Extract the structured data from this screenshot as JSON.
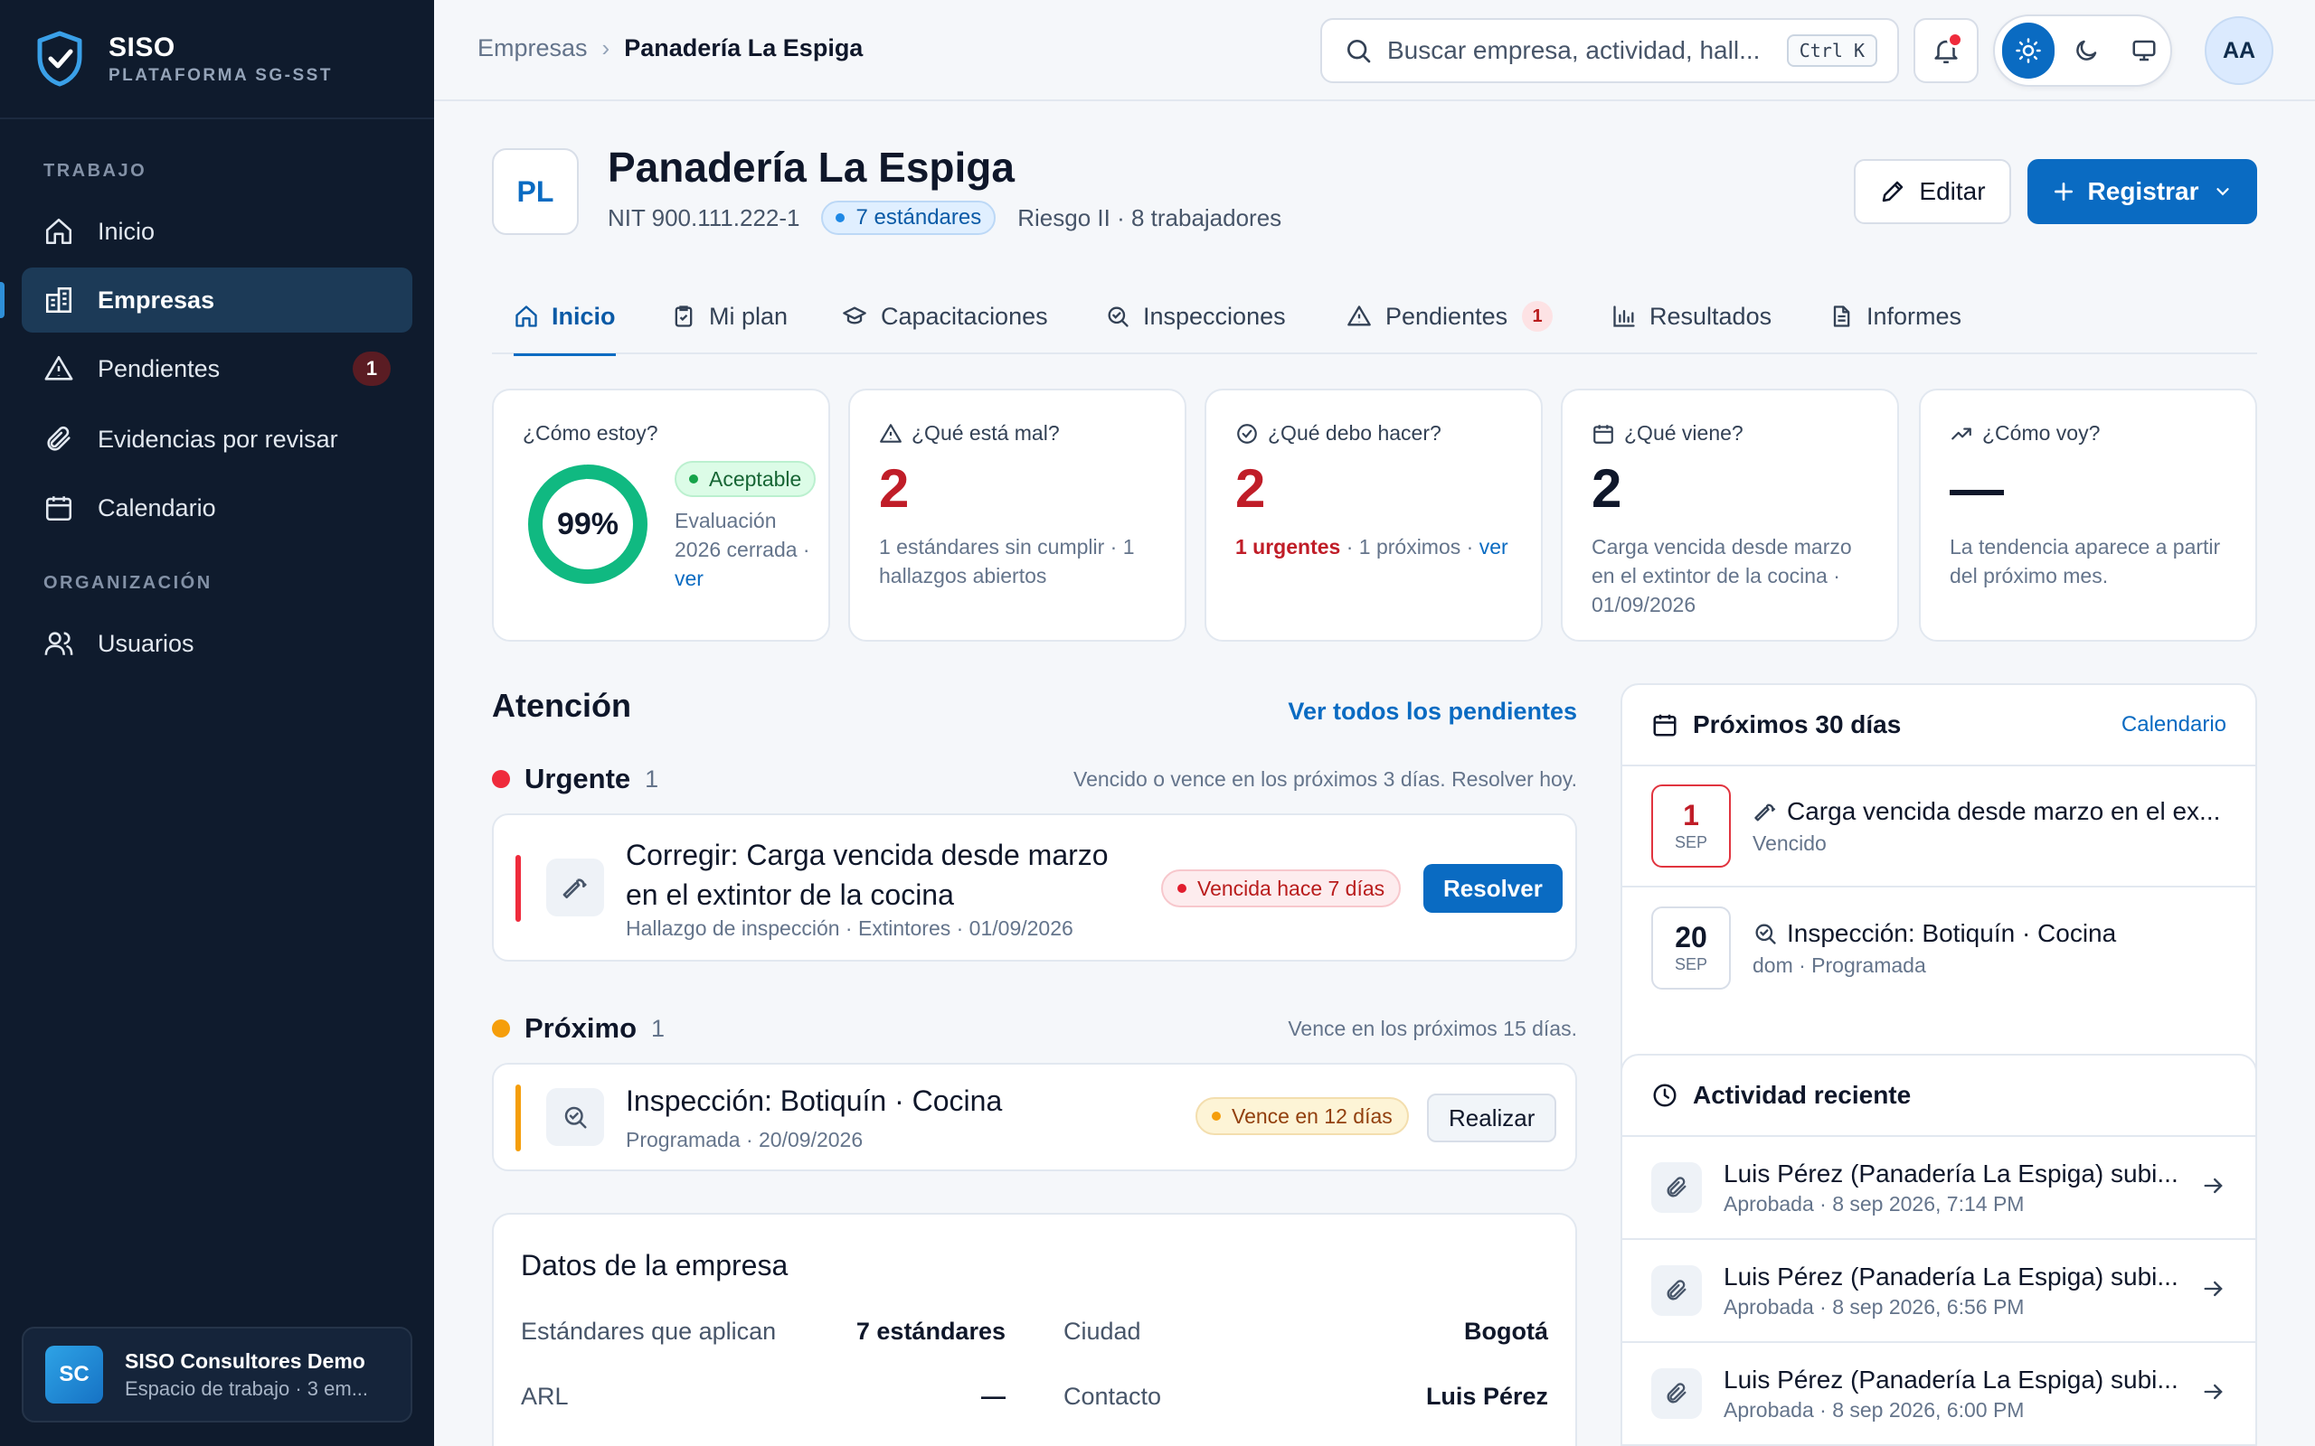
{
  "brand": {
    "name": "SISO",
    "subtitle": "PLATAFORMA SG-SST"
  },
  "sidebar": {
    "section_work": "TRABAJO",
    "section_org": "ORGANIZACIÓN",
    "items": [
      {
        "label": "Inicio"
      },
      {
        "label": "Empresas"
      },
      {
        "label": "Pendientes",
        "badge": "1"
      },
      {
        "label": "Evidencias por revisar"
      },
      {
        "label": "Calendario"
      },
      {
        "label": "Usuarios"
      }
    ],
    "workspace": {
      "initials": "SC",
      "name": "SISO Consultores Demo",
      "sub": "Espacio de trabajo · 3 em..."
    }
  },
  "topbar": {
    "breadcrumb": [
      "Empresas",
      "Panadería La Espiga"
    ],
    "search_placeholder": "Buscar empresa, actividad, hall...",
    "shortcut": "Ctrl K",
    "user_initials": "AA"
  },
  "company": {
    "initials": "PL",
    "name": "Panadería La Espiga",
    "nit": "NIT 900.111.222-1",
    "standards_pill": "7 estándares",
    "risk": "Riesgo II · 8 trabajadores",
    "edit_label": "Editar",
    "register_label": "Registrar"
  },
  "tabs": [
    {
      "label": "Inicio"
    },
    {
      "label": "Mi plan"
    },
    {
      "label": "Capacitaciones"
    },
    {
      "label": "Inspecciones"
    },
    {
      "label": "Pendientes",
      "badge": "1"
    },
    {
      "label": "Resultados"
    },
    {
      "label": "Informes"
    }
  ],
  "kpis": {
    "status": {
      "title": "¿Cómo estoy?",
      "percent": "99%",
      "percent_value": 99,
      "badge": "Aceptable",
      "desc_a": "Evaluación 2026 cerrada · ",
      "desc_link": "ver"
    },
    "wrong": {
      "title": "¿Qué está mal?",
      "value": "2",
      "desc": "1 estándares sin cumplir · 1 hallazgos abiertos"
    },
    "todo": {
      "title": "¿Qué debo hacer?",
      "value": "2",
      "desc_urgent": "1 urgentes",
      "desc_rest": " · 1 próximos · ",
      "desc_link": "ver"
    },
    "next": {
      "title": "¿Qué viene?",
      "value": "2",
      "desc": "Carga vencida desde marzo en el extintor de la cocina · 01/09/2026"
    },
    "trend": {
      "title": "¿Cómo voy?",
      "value": "—",
      "desc": "La tendencia aparece a partir del próximo mes."
    }
  },
  "attention": {
    "title": "Atención",
    "see_all": "Ver todos los pendientes",
    "urgent": {
      "label": "Urgente",
      "count": "1",
      "note": "Vencido o vence en los próximos 3 días. Resolver hoy.",
      "task": {
        "title": "Corregir: Carga vencida desde marzo en el extintor de la cocina",
        "meta": "Hallazgo de inspección · Extintores    · 01/09/2026",
        "chip": "Vencida hace 7 días",
        "action": "Resolver"
      }
    },
    "upcoming": {
      "label": "Próximo",
      "count": "1",
      "note": "Vence en los próximos 15 días.",
      "task": {
        "title": "Inspección: Botiquín · Cocina",
        "meta": "Programada   · 20/09/2026",
        "chip": "Vence en 12 días",
        "action": "Realizar"
      }
    }
  },
  "company_data": {
    "title": "Datos de la empresa",
    "rows": [
      {
        "label": "Estándares que aplican",
        "value": "7 estándares",
        "label2": "Ciudad",
        "value2": "Bogotá"
      },
      {
        "label": "ARL",
        "value": "—",
        "label2": "Contacto",
        "value2": "Luis Pérez"
      }
    ]
  },
  "upcoming30": {
    "title": "Próximos 30 días",
    "link": "Calendario",
    "events": [
      {
        "day": "1",
        "month": "SEP",
        "title": "Carga vencida desde marzo en el ex...",
        "sub": "Vencido"
      },
      {
        "day": "20",
        "month": "SEP",
        "title": "Inspección: Botiquín · Cocina",
        "sub": "dom · Programada"
      }
    ]
  },
  "activity": {
    "title": "Actividad reciente",
    "items": [
      {
        "title": "Luis Pérez (Panadería La Espiga) subi...",
        "sub": "Aprobada · 8 sep 2026, 7:14 PM"
      },
      {
        "title": "Luis Pérez (Panadería La Espiga) subi...",
        "sub": "Aprobada · 8 sep 2026, 6:56 PM"
      },
      {
        "title": "Luis Pérez (Panadería La Espiga) subi...",
        "sub": "Aprobada · 8 sep 2026, 6:00 PM"
      }
    ]
  },
  "colors": {
    "primary": "#0a6bc2",
    "sidebar": "#0f1b2d",
    "danger": "#c01d28",
    "success": "#10b981",
    "warning": "#f59e0b"
  }
}
